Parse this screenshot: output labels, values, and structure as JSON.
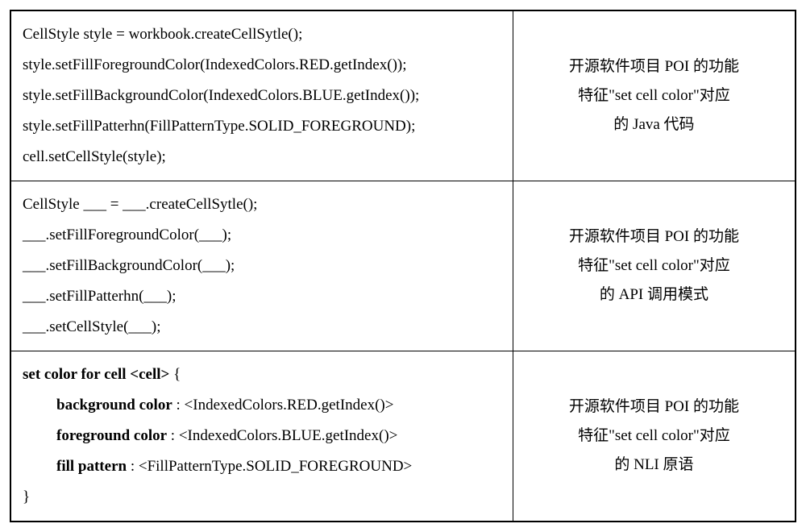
{
  "rows": [
    {
      "left": {
        "lines": [
          {
            "text": "CellStyle style = workbook.createCellSytle();",
            "bold": false,
            "indent": false
          },
          {
            "text": "style.setFillForegroundColor(IndexedColors.RED.getIndex());",
            "bold": false,
            "indent": false
          },
          {
            "text": "style.setFillBackgroundColor(IndexedColors.BLUE.getIndex());",
            "bold": false,
            "indent": false
          },
          {
            "text": "style.setFillPatterhn(FillPatternType.SOLID_FOREGROUND);",
            "bold": false,
            "indent": false
          },
          {
            "text": "cell.setCellStyle(style);",
            "bold": false,
            "indent": false
          }
        ]
      },
      "right": {
        "line1": "开源软件项目 POI 的功能",
        "line2": "特征\"set cell color\"对应",
        "line3": "的 Java 代码"
      }
    },
    {
      "left": {
        "lines": [
          {
            "text": "CellStyle ___ = ___.createCellSytle();",
            "bold": false,
            "indent": false
          },
          {
            "text": "___.setFillForegroundColor(___);",
            "bold": false,
            "indent": false
          },
          {
            "text": "___.setFillBackgroundColor(___);",
            "bold": false,
            "indent": false
          },
          {
            "text": "___.setFillPatterhn(___);",
            "bold": false,
            "indent": false
          },
          {
            "text": "___.setCellStyle(___);",
            "bold": false,
            "indent": false
          }
        ]
      },
      "right": {
        "line1": "开源软件项目 POI 的功能",
        "line2": "特征\"set cell color\"对应",
        "line3": "的 API 调用模式"
      }
    },
    {
      "left": {
        "lines": [
          {
            "prefix_bold": "set color for cell <cell>",
            "suffix": " {",
            "indent": false
          },
          {
            "prefix_bold": "background color",
            "suffix": " : <IndexedColors.RED.getIndex()>",
            "indent": true
          },
          {
            "prefix_bold": "foreground color",
            "suffix": " : <IndexedColors.BLUE.getIndex()>",
            "indent": true
          },
          {
            "prefix_bold": "fill pattern",
            "suffix": " : <FillPatternType.SOLID_FOREGROUND>",
            "indent": true
          },
          {
            "text": "}",
            "bold": false,
            "indent": false
          }
        ]
      },
      "right": {
        "line1": "开源软件项目 POI 的功能",
        "line2": "特征\"set cell color\"对应",
        "line3": "的 NLI 原语"
      }
    }
  ]
}
